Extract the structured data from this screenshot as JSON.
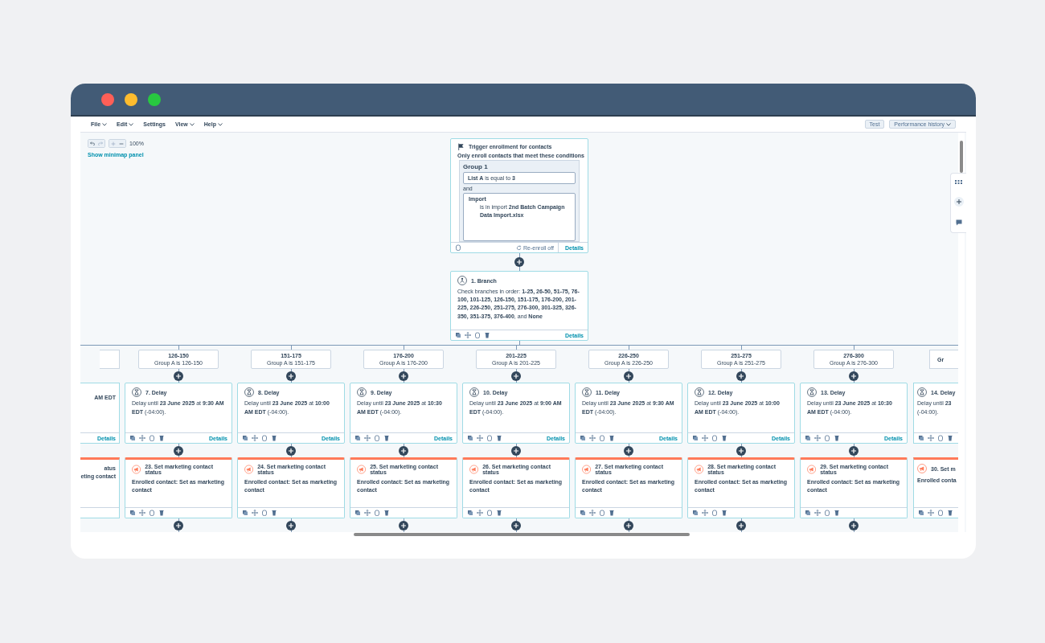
{
  "window": {
    "lights": [
      {
        "color": "#ff5f57"
      },
      {
        "color": "#febc2e"
      },
      {
        "color": "#28c840"
      }
    ]
  },
  "menu": [
    {
      "label": "File",
      "caret": true
    },
    {
      "label": "Edit",
      "caret": true
    },
    {
      "label": "Settings",
      "caret": false
    },
    {
      "label": "View",
      "caret": true
    },
    {
      "label": "Help",
      "caret": true
    }
  ],
  "actions": [
    {
      "label": "Test",
      "caret": false
    },
    {
      "label": "Performance history",
      "caret": true
    }
  ],
  "toolbar": {
    "zoom": "100%",
    "minimap_link": "Show minimap panel"
  },
  "trigger": {
    "title": "Trigger enrollment for contacts",
    "subtitle": "Only enroll contacts that meet these conditions",
    "group_title": "Group 1",
    "filter": "**List A** is equal to **3**",
    "joiner": "and",
    "import_title": "Import",
    "import_text": "is in import **2nd Batch Campaign Data Import.xlsx**",
    "reenroll": "Re-enroll off",
    "details": "Details"
  },
  "branch": {
    "title": "1. Branch",
    "text": "Check branches in order: **1-25, 26-50, 51-75, 76-100, 101-125, 126-150, 151-175, 176-200, 201-225, 226-250, 251-275, 276-300, 301-325, 326-350, 351-375, 376-400**, and **None**",
    "details": "Details"
  },
  "columns": [
    {
      "kind": "cut-left",
      "delay": {
        "text": "**AM EDT**",
        "details": "Details"
      },
      "status": {
        "title": "atus",
        "text": "eting contact"
      }
    },
    {
      "kind": "full",
      "label": "126-150",
      "sublabel": "Group A is 126-150",
      "delay": {
        "title": "7. Delay",
        "text": "Delay until **23 June 2025** at **9:30 AM EDT** (-04:00).",
        "details": "Details"
      },
      "status": {
        "title": "23. Set marketing contact status",
        "text": "Enrolled contact: Set as marketing contact"
      }
    },
    {
      "kind": "full",
      "label": "151-175",
      "sublabel": "Group A is 151-175",
      "delay": {
        "title": "8. Delay",
        "text": "Delay until **23 June 2025** at **10:00 AM EDT** (-04:00).",
        "details": "Details"
      },
      "status": {
        "title": "24. Set marketing contact status",
        "text": "Enrolled contact: Set as marketing contact"
      }
    },
    {
      "kind": "full",
      "label": "176-200",
      "sublabel": "Group A is 176-200",
      "delay": {
        "title": "9. Delay",
        "text": "Delay until **23 June 2025** at **10:30 AM EDT** (-04:00).",
        "details": "Details"
      },
      "status": {
        "title": "25. Set marketing contact status",
        "text": "Enrolled contact: Set as marketing contact"
      }
    },
    {
      "kind": "full",
      "label": "201-225",
      "sublabel": "Group A is 201-225",
      "delay": {
        "title": "10. Delay",
        "text": "Delay until **23 June 2025** at **9:00 AM EDT** (-04:00).",
        "details": "Details"
      },
      "status": {
        "title": "26. Set marketing contact status",
        "text": "Enrolled contact: Set as marketing contact"
      }
    },
    {
      "kind": "full",
      "label": "226-250",
      "sublabel": "Group A is 226-250",
      "delay": {
        "title": "11. Delay",
        "text": "Delay until **23 June 2025** at **9:30 AM EDT** (-04:00).",
        "details": "Details"
      },
      "status": {
        "title": "27. Set marketing contact status",
        "text": "Enrolled contact: Set as marketing contact"
      }
    },
    {
      "kind": "full",
      "label": "251-275",
      "sublabel": "Group A is 251-275",
      "delay": {
        "title": "12. Delay",
        "text": "Delay until **23 June 2025** at **10:00 AM EDT** (-04:00).",
        "details": "Details"
      },
      "status": {
        "title": "28. Set marketing contact status",
        "text": "Enrolled contact: Set as marketing contact"
      }
    },
    {
      "kind": "full",
      "label": "276-300",
      "sublabel": "Group A is 276-300",
      "delay": {
        "title": "13. Delay",
        "text": "Delay until **23 June 2025** at **10:30 AM EDT** (-04:00).",
        "details": "Details"
      },
      "status": {
        "title": "29. Set marketing contact status",
        "text": "Enrolled contact: Set as marketing contact"
      }
    },
    {
      "kind": "cut-right",
      "label": "Gr",
      "delay": {
        "title": "14. Delay",
        "text": "Delay until **23**\n(-04:00)."
      },
      "status": {
        "title": "30. Set m",
        "text": "Enrolled conta"
      }
    }
  ]
}
